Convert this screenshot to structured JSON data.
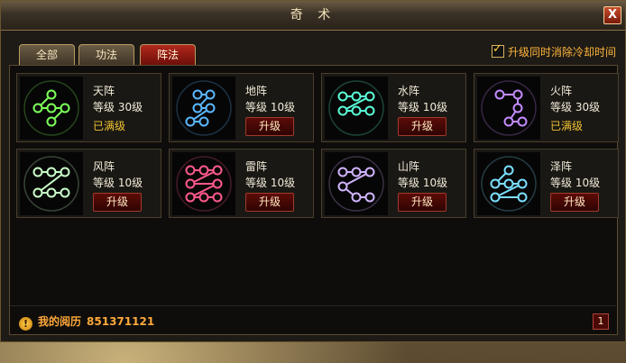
{
  "window": {
    "title": "奇 术",
    "close_label": "X"
  },
  "tabs": [
    {
      "label": "全部"
    },
    {
      "label": "功法"
    },
    {
      "label": "阵法"
    }
  ],
  "option": {
    "label": "升级同时消除冷却时间",
    "checked": true
  },
  "formations": [
    {
      "name": "天阵",
      "level": "等级  30级",
      "status": "已满级",
      "icon": "tian-formation-icon",
      "color": "#7dff5a"
    },
    {
      "name": "地阵",
      "level": "等级  10级",
      "button": "升级",
      "icon": "di-formation-icon",
      "color": "#5ab8ff"
    },
    {
      "name": "水阵",
      "level": "等级  10级",
      "button": "升级",
      "icon": "shui-formation-icon",
      "color": "#5affd8"
    },
    {
      "name": "火阵",
      "level": "等级  30级",
      "status": "已满级",
      "icon": "huo-formation-icon",
      "color": "#c48cff"
    },
    {
      "name": "风阵",
      "level": "等级  10级",
      "button": "升级",
      "icon": "feng-formation-icon",
      "color": "#c8ffc8"
    },
    {
      "name": "雷阵",
      "level": "等级  10级",
      "button": "升级",
      "icon": "lei-formation-icon",
      "color": "#ff5a8c"
    },
    {
      "name": "山阵",
      "level": "等级  10级",
      "button": "升级",
      "icon": "shan-formation-icon",
      "color": "#d0b4ff"
    },
    {
      "name": "泽阵",
      "level": "等级  10级",
      "button": "升级",
      "icon": "ze-formation-icon",
      "color": "#7ae0ff"
    }
  ],
  "footer": {
    "exp_label": "我的阅历",
    "exp_value": "851371121",
    "page": "1"
  }
}
